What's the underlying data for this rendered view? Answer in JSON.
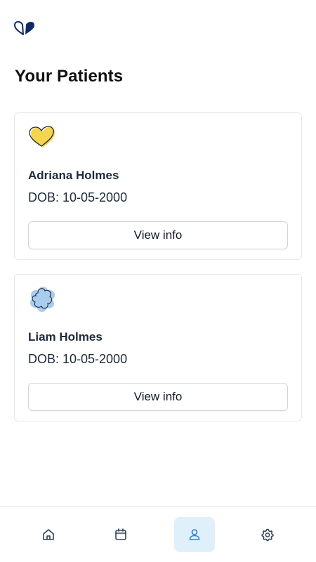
{
  "app": {
    "logo_icon": "split-heart-logo-icon",
    "accent_color": "#2f80d1",
    "brand_color": "#0f2a66"
  },
  "page": {
    "title": "Your Patients"
  },
  "patients": [
    {
      "name": "Adriana Holmes",
      "dob": "DOB: 10-05-2000",
      "avatar_icon": "yellow-heart-icon",
      "avatar_color": "#f6d54e",
      "button_label": "View info"
    },
    {
      "name": "Liam Holmes",
      "dob": "DOB: 10-05-2000",
      "avatar_icon": "blue-flower-icon",
      "avatar_color": "#a9cdee",
      "button_label": "View info"
    }
  ],
  "bottom_nav": {
    "items": [
      {
        "id": "home",
        "icon": "home-icon",
        "active": false
      },
      {
        "id": "calendar",
        "icon": "calendar-icon",
        "active": false
      },
      {
        "id": "patients",
        "icon": "user-icon",
        "active": true
      },
      {
        "id": "settings",
        "icon": "gear-icon",
        "active": false
      }
    ]
  }
}
